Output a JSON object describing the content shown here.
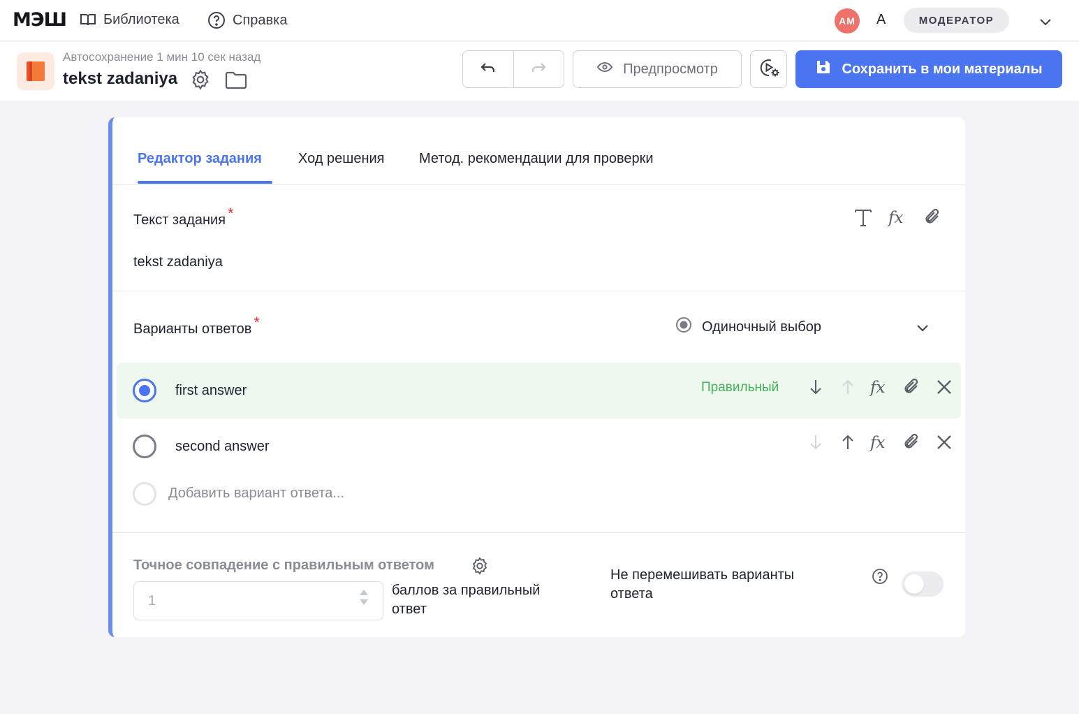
{
  "nav": {
    "logo": "МЭШ",
    "library_label": "Библиотека",
    "help_label": "Справка",
    "avatar_initials": "АМ",
    "user_initial": "А",
    "role": "МОДЕРАТОР"
  },
  "header": {
    "autosave": "Автосохранение 1 мин 10 сек назад",
    "title": "tekst zadaniya",
    "preview_label": "Предпросмотр",
    "save_label": "Сохранить в мои материалы"
  },
  "tabs": [
    {
      "label": "Редактор задания",
      "active": true
    },
    {
      "label": "Ход решения",
      "active": false
    },
    {
      "label": "Метод. рекомендации для проверки",
      "active": false
    }
  ],
  "task": {
    "label": "Текст задания",
    "required_mark": "*",
    "text": "tekst zadaniya"
  },
  "answers": {
    "label": "Варианты ответов",
    "required_mark": "*",
    "mode": "Одиночный выбор",
    "items": [
      {
        "text": "first answer",
        "correct": true,
        "correct_label": "Правильный"
      },
      {
        "text": "second answer",
        "correct": false
      }
    ],
    "add_placeholder": "Добавить вариант ответа..."
  },
  "scoring": {
    "exact_match_label": "Точное совпадение с правильным ответом",
    "points_value": "1",
    "points_caption": "баллов за правильный ответ",
    "shuffle_caption": "Не перемешивать варианты ответа",
    "shuffle_enabled": false
  },
  "colors": {
    "accent": "#4b74f0",
    "correct_bg": "#eef8ee",
    "correct_text": "#45b05a",
    "required": "#e0303a",
    "avatar": "#f0706a"
  }
}
